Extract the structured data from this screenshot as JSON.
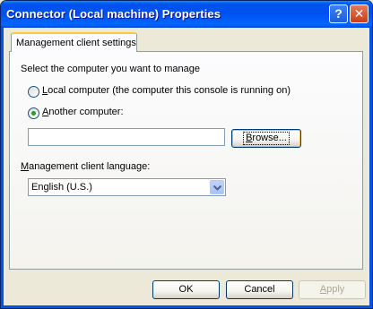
{
  "window": {
    "title": "Connector (Local machine) Properties",
    "help_glyph": "?",
    "close_glyph": "✕"
  },
  "tabs": [
    {
      "label": "Management client settings",
      "selected": true
    }
  ],
  "panel": {
    "prompt": "Select the computer you want to manage",
    "radio_local": {
      "key": "L",
      "label_rest": "ocal computer (the computer this console is running on)",
      "checked": false
    },
    "radio_another": {
      "key": "A",
      "label_rest": "nother computer:",
      "checked": true
    },
    "computer_name_value": "",
    "browse_button": {
      "key": "B",
      "label_rest": "rowse..."
    },
    "language_label": {
      "key": "M",
      "label_rest": "anagement client language:"
    },
    "language_select": {
      "value": "English (U.S.)",
      "options_visible": [
        "English (U.S.)"
      ]
    }
  },
  "footer": {
    "ok": "OK",
    "cancel": "Cancel",
    "apply": {
      "key": "A",
      "label_rest": "pply",
      "enabled": false
    }
  },
  "colors": {
    "titlebar": "#0054e3",
    "dialog_bg": "#ece9d8",
    "tab_highlight": "#ffc83c",
    "radio_dot": "#21a121"
  }
}
